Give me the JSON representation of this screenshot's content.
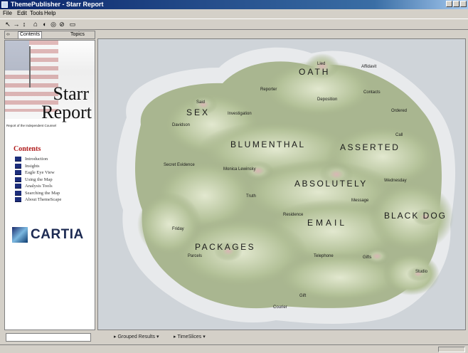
{
  "window": {
    "title": "ThemePublisher - Starr Report"
  },
  "menu": [
    "File",
    "Edit",
    "Tools",
    "Help"
  ],
  "toolbar": {
    "buttons": [
      "back",
      "forward",
      "up",
      "home",
      "print",
      "refresh",
      "stop",
      "settings"
    ]
  },
  "left_tabs": {
    "contents": "Contents",
    "topics": "Topics"
  },
  "banner": {
    "title_line1": "Starr",
    "title_line2": "Report",
    "subtitle": "Report of the Independent Counsel"
  },
  "contents": {
    "title": "Contents",
    "items": [
      "Introduction",
      "Insights",
      "Eagle Eye View",
      "Using the Map",
      "Analysis Tools",
      "Searching the Map",
      "About ThemeScape"
    ]
  },
  "logo": {
    "text": "CARTIA"
  },
  "map": {
    "theme_labels": [
      "OATH",
      "SEX",
      "BLUMENTHAL",
      "ASSERTED",
      "ABSOLUTELY",
      "EMAIL",
      "BLACK DOG",
      "PACKAGES"
    ],
    "labels": [
      "Lied",
      "Affidavit",
      "Reporter",
      "Deposition",
      "Contacts",
      "Said",
      "Davidson",
      "Investigation",
      "Ordered",
      "Secret Evidence",
      "Monica Lewinsky",
      "Truth",
      "Wednesday",
      "Residence",
      "Message",
      "Friday",
      "Parcels",
      "Courier",
      "Gift",
      "Telephone",
      "Studio",
      "Gifts",
      "Call"
    ]
  },
  "bottom": {
    "tab1": "Grouped Results",
    "tab2": "TimeSlices"
  }
}
